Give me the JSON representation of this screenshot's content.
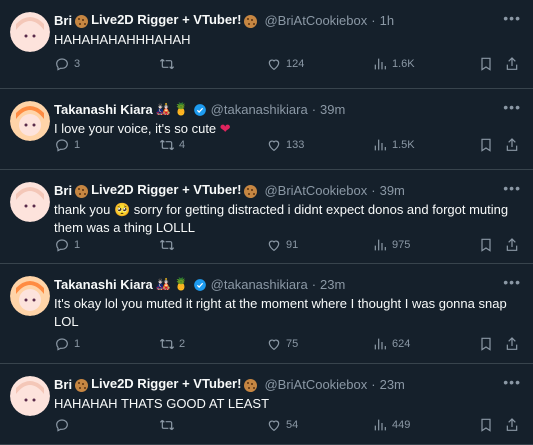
{
  "tweets": [
    {
      "name": "Bri",
      "name_suffix": "Live2D Rigger + VTuber!",
      "handle": "@BriAtCookiebox",
      "time": "1h",
      "text": "HAHAHAHAHHHAHAH",
      "replies": "3",
      "retweets": "",
      "likes": "124",
      "views": "1.6K",
      "verified": false,
      "avatar_colors": [
        "#f4c7b8",
        "#fde3dc"
      ]
    },
    {
      "name": "Takanashi Kiara",
      "name_suffix": "",
      "handle": "@takanashikiara",
      "time": "39m",
      "text": "I love your voice, it's so cute",
      "replies": "1",
      "retweets": "4",
      "likes": "133",
      "views": "1.5K",
      "verified": true,
      "avatar_colors": [
        "#ff8c42",
        "#ffd4a8"
      ]
    },
    {
      "name": "Bri",
      "name_suffix": "Live2D Rigger + VTuber!",
      "handle": "@BriAtCookiebox",
      "time": "39m",
      "text": "thank you 🥺 sorry for getting distracted i didnt expect donos and forgot muting them was a thing LOLLL",
      "replies": "1",
      "retweets": "",
      "likes": "91",
      "views": "975",
      "verified": false,
      "avatar_colors": [
        "#f4c7b8",
        "#fde3dc"
      ]
    },
    {
      "name": "Takanashi Kiara",
      "name_suffix": "",
      "handle": "@takanashikiara",
      "time": "23m",
      "text": "It's okay lol you muted it right at the moment where I thought I was gonna snap LOL",
      "replies": "1",
      "retweets": "2",
      "likes": "75",
      "views": "624",
      "verified": true,
      "avatar_colors": [
        "#ff8c42",
        "#ffd4a8"
      ]
    },
    {
      "name": "Bri",
      "name_suffix": "Live2D Rigger + VTuber!",
      "handle": "@BriAtCookiebox",
      "time": "23m",
      "text": "HAHAHAH THATS GOOD AT LEAST",
      "replies": "",
      "retweets": "",
      "likes": "54",
      "views": "449",
      "verified": false,
      "avatar_colors": [
        "#f4c7b8",
        "#fde3dc"
      ]
    }
  ],
  "colors": {
    "background": "#15202b",
    "text": "#f7f9f9",
    "muted": "#8b98a5",
    "divider": "#38444d",
    "verified": "#1d9bf0",
    "heart": "#f91880"
  }
}
